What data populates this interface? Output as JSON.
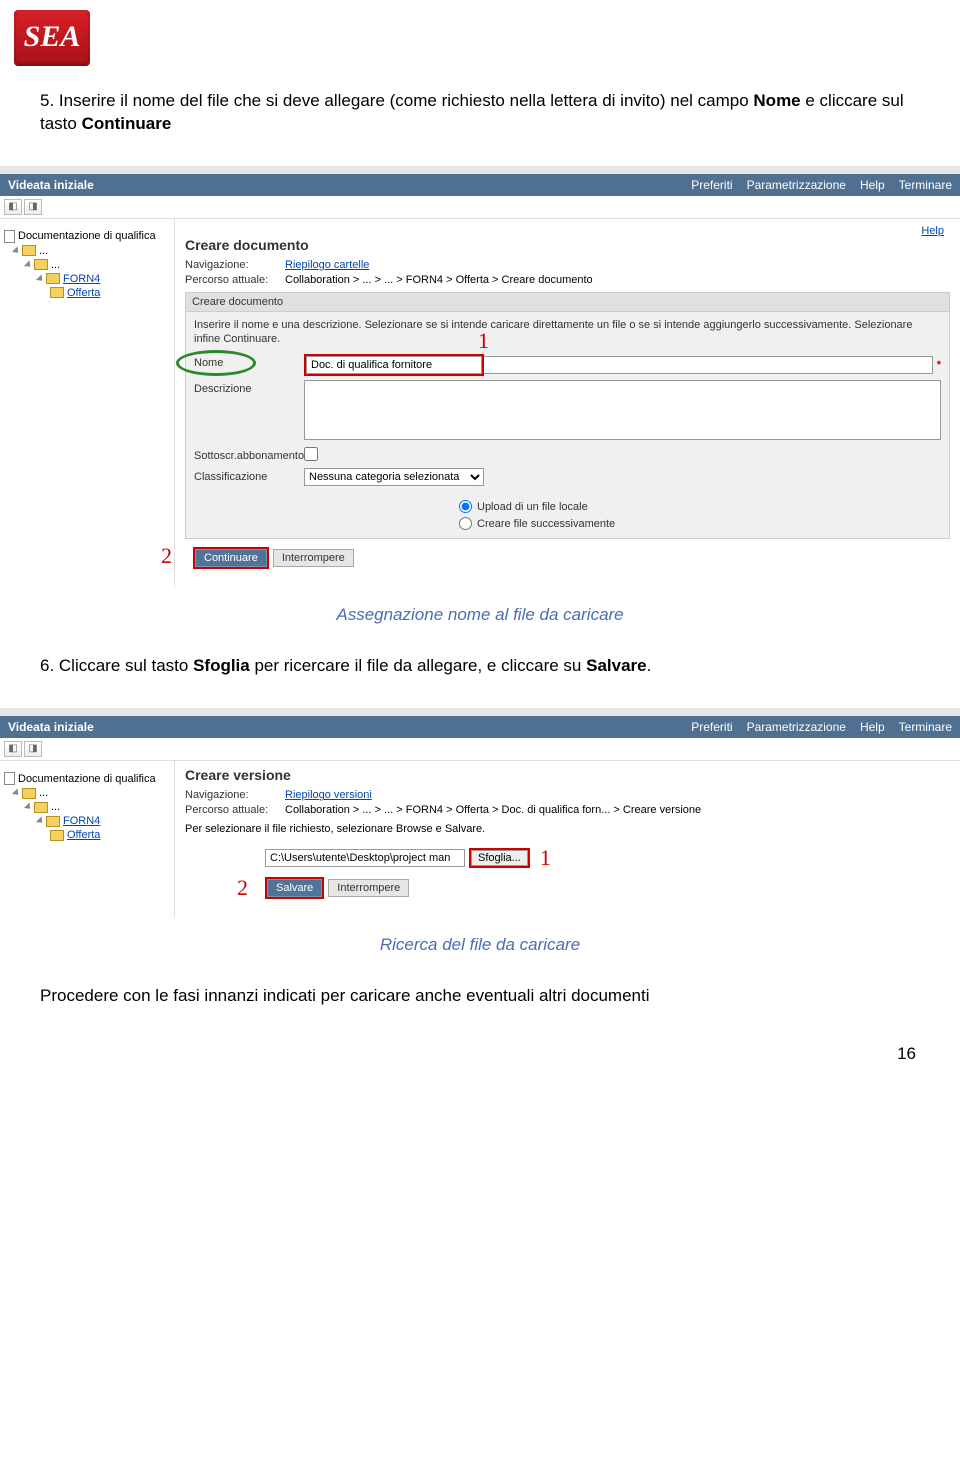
{
  "logo": "SEA",
  "step5": {
    "prefix": "5. Inserire il nome del file che si deve allegare (come richiesto nella lettera di invito) nel campo ",
    "bold1": "Nome",
    "mid": " e cliccare sul tasto ",
    "bold2": "Continuare"
  },
  "screenshot1": {
    "header": {
      "title": "Videata iniziale",
      "pref": "Preferiti",
      "param": "Parametrizzazione",
      "help": "Help",
      "term": "Terminare"
    },
    "help_link": "Help",
    "tree": {
      "root": "Documentazione di qualifica",
      "dots": "...",
      "forn": "FORN4",
      "offerta": "Offerta"
    },
    "pane_title": "Creare documento",
    "nav_label": "Navigazione:",
    "nav_link": "Riepilogo cartelle",
    "path_label": "Percorso attuale:",
    "path": "Collaboration > ... > ... > FORN4 > Offerta > Creare documento",
    "section_hdr": "Creare documento",
    "instr": "Inserire il nome e una descrizione. Selezionare se si intende caricare direttamente un file o se si intende aggiungerlo successivamente. Selezionare infine Continuare.",
    "nome_label": "Nome",
    "nome_value": "Doc. di qualifica fornitore",
    "desc_label": "Descrizione",
    "sub_label": "Sottoscr.abbonamento",
    "class_label": "Classificazione",
    "class_value": "Nessuna categoria selezionata",
    "radio1": "Upload di un file locale",
    "radio2": "Creare file successivamente",
    "btn_cont": "Continuare",
    "btn_int": "Interrompere",
    "callout1": "1",
    "callout2": "2"
  },
  "caption1": "Assegnazione nome al file da caricare",
  "step6": {
    "prefix": "6. Cliccare sul tasto ",
    "bold1": "Sfoglia",
    "mid": " per ricercare il file da allegare, e cliccare su ",
    "bold2": "Salvare",
    "suffix": "."
  },
  "screenshot2": {
    "header": {
      "title": "Videata iniziale",
      "pref": "Preferiti",
      "param": "Parametrizzazione",
      "help": "Help",
      "term": "Terminare"
    },
    "tree": {
      "root": "Documentazione di qualifica",
      "dots": "...",
      "forn": "FORN4",
      "offerta": "Offerta"
    },
    "pane_title": "Creare versione",
    "nav_label": "Navigazione:",
    "nav_link": "Riepilogo versioni",
    "path_label": "Percorso attuale:",
    "path": "Collaboration > ... > ... > FORN4 > Offerta > Doc. di qualifica forn... > Creare versione",
    "instr": "Per selezionare il file richiesto, selezionare Browse e Salvare.",
    "file_value": "C:\\Users\\utente\\Desktop\\project man",
    "browse": "Sfoglia...",
    "btn_save": "Salvare",
    "btn_int": "Interrompere",
    "callout1": "1",
    "callout2": "2"
  },
  "caption2": "Ricerca del file da caricare",
  "closing": "Procedere con le fasi innanzi indicati per caricare anche eventuali altri documenti",
  "pagenum": "16"
}
